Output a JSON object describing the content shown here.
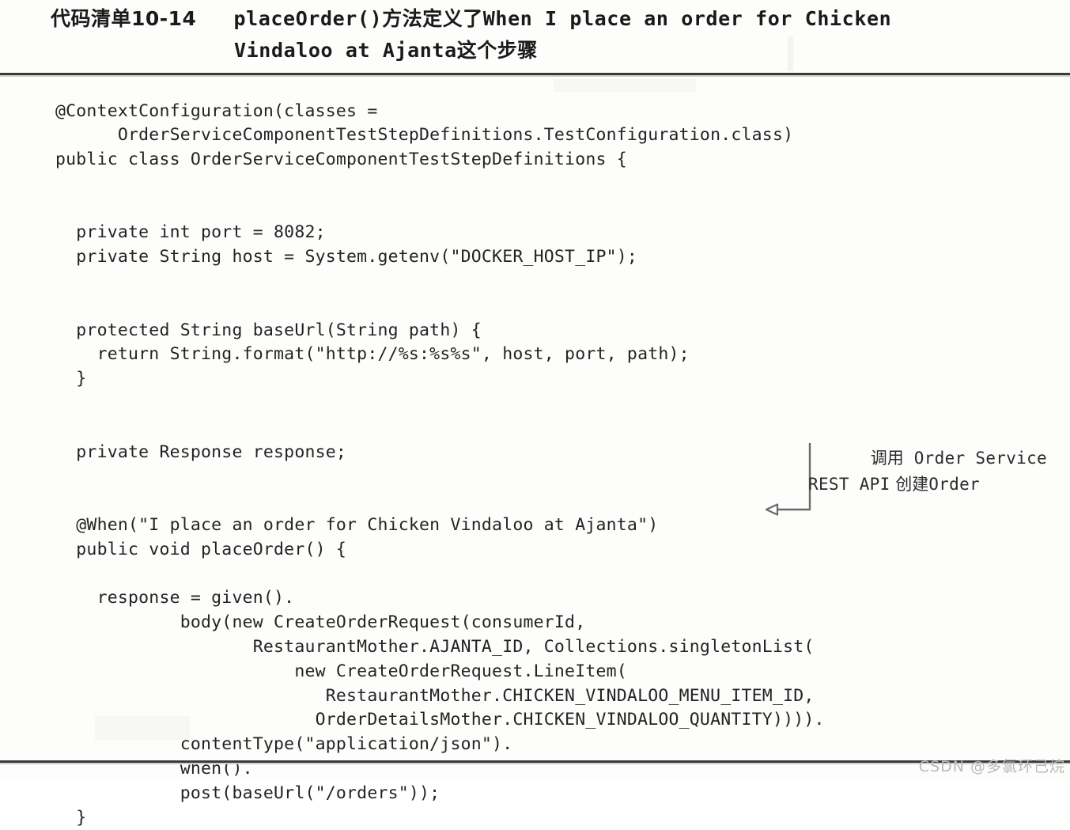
{
  "caption": {
    "label_cn": "代码清单10-14",
    "segment_mono_1": "placeOrder()",
    "segment_cn_1": "方法定义了",
    "segment_mono_2": "When I place an order for Chicken",
    "segment_mono_3": "Vindaloo at Ajanta",
    "segment_cn_2": "这个步骤"
  },
  "code": {
    "language": "java",
    "lines": [
      "@ContextConfiguration(classes =",
      "      OrderServiceComponentTestStepDefinitions.TestConfiguration.class)",
      "public class OrderServiceComponentTestStepDefinitions {",
      "",
      "",
      "  private int port = 8082;",
      "  private String host = System.getenv(\"DOCKER_HOST_IP\");",
      "",
      "",
      "  protected String baseUrl(String path) {",
      "    return String.format(\"http://%s:%s%s\", host, port, path);",
      "  }",
      "",
      "",
      "  private Response response;",
      "",
      "",
      "  @When(\"I place an order for Chicken Vindaloo at Ajanta\")",
      "  public void placeOrder() {",
      "",
      "    response = given().",
      "            body(new CreateOrderRequest(consumerId,",
      "                   RestaurantMother.AJANTA_ID, Collections.singletonList(",
      "                       new CreateOrderRequest.LineItem(",
      "                          RestaurantMother.CHICKEN_VINDALOO_MENU_ITEM_ID,",
      "                         OrderDetailsMother.CHICKEN_VINDALOO_QUANTITY)))).",
      "            contentType(\"application/json\").",
      "            when().",
      "            post(baseUrl(\"/orders\"));",
      "  }"
    ]
  },
  "annotation": {
    "line1_cn": "调用",
    "line1_mono": "Order Service",
    "line2_mono": "REST API",
    "line2_cn": "创建",
    "line2_mono_tail": "Order",
    "full_text": "调用 Order Service REST API 创建 Order",
    "arrow_direction": "left"
  },
  "watermark": {
    "text": "CSDN @多氯环己烷"
  },
  "colors": {
    "page_background": "#fdfdfc",
    "rule": "#3a3a3a",
    "code_text": "#232323",
    "annotation_text": "#2b2b2b",
    "watermark_text": "#b9b9b9"
  }
}
